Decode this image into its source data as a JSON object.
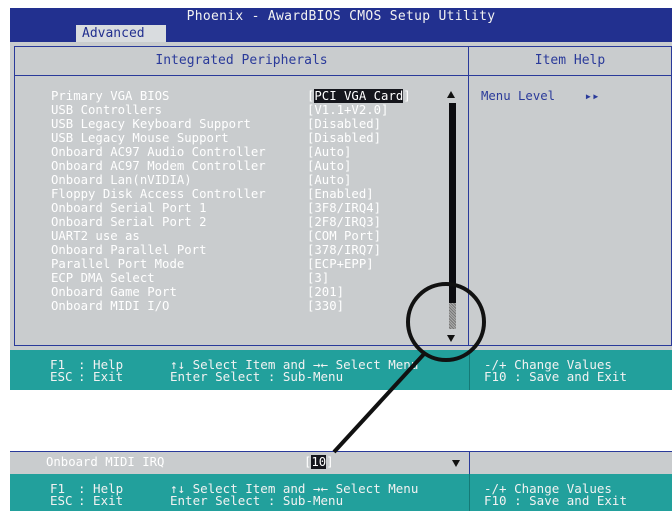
{
  "app_title": "Phoenix - AwardBIOS CMOS Setup Utility",
  "active_tab": "Advanced",
  "section_title": "Integrated Peripherals",
  "help_title": "Item Help",
  "help_text": "Menu Level",
  "help_arrows": "▸▸",
  "items": [
    {
      "label": "Primary VGA BIOS",
      "value": "PCI VGA Card",
      "selected": true
    },
    {
      "label": "USB Controllers",
      "value": "V1.1+V2.0"
    },
    {
      "label": "USB Legacy Keyboard Support",
      "value": "Disabled"
    },
    {
      "label": "USB Legacy Mouse Support",
      "value": "Disabled"
    },
    {
      "label": "Onboard AC97 Audio Controller",
      "value": "Auto"
    },
    {
      "label": "Onboard AC97 Modem Controller",
      "value": "Auto"
    },
    {
      "label": "Onboard Lan(nVIDIA)",
      "value": "Auto"
    },
    {
      "label": "Floppy Disk Access Controller",
      "value": "Enabled"
    },
    {
      "label": "Onboard Serial Port 1",
      "value": "3F8/IRQ4"
    },
    {
      "label": "Onboard Serial Port 2",
      "value": "2F8/IRQ3"
    },
    {
      "label": "UART2 use as",
      "value": "COM Port"
    },
    {
      "label": "Onboard Parallel Port",
      "value": "378/IRQ7"
    },
    {
      "label": "Parallel Port Mode",
      "value": "ECP+EPP"
    },
    {
      "label": "ECP DMA Select",
      "value": "3"
    },
    {
      "label": "Onboard Game Port",
      "value": "201"
    },
    {
      "label": "Onboard MIDI I/O",
      "value": "330"
    }
  ],
  "zoom_item": {
    "label": "Onboard MIDI IRQ",
    "value": "10"
  },
  "footer": {
    "f1_key": "F1",
    "f1_text": ": Help",
    "esc_key": "ESC",
    "esc_text": ": Exit",
    "nav_text": "↑↓ Select Item and →← Select Menu",
    "enter_text": "Enter Select : Sub-Menu",
    "change_text": "-/+ Change Values",
    "f10_text": "F10 : Save and Exit"
  },
  "colors": {
    "bios_blue": "#22308f",
    "panel_gray": "#c9ccce",
    "footer_teal": "#22a09c"
  }
}
